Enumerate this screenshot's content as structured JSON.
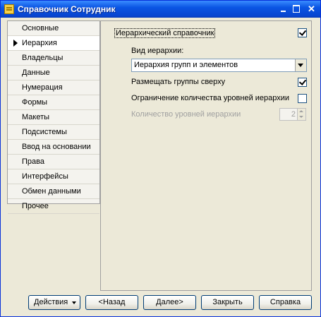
{
  "window": {
    "title": "Справочник Сотрудник"
  },
  "sidebar": {
    "items": [
      {
        "label": "Основные"
      },
      {
        "label": "Иерархия"
      },
      {
        "label": "Владельцы"
      },
      {
        "label": "Данные"
      },
      {
        "label": "Нумерация"
      },
      {
        "label": "Формы"
      },
      {
        "label": "Макеты"
      },
      {
        "label": "Подсистемы"
      },
      {
        "label": "Ввод на основании"
      },
      {
        "label": "Права"
      },
      {
        "label": "Интерфейсы"
      },
      {
        "label": "Обмен данными"
      },
      {
        "label": "Прочее"
      }
    ],
    "active_index": 1
  },
  "panel": {
    "hierarchical": {
      "label": "Иерархический справочник",
      "checked": true
    },
    "hierarchy_type": {
      "label": "Вид иерархии:",
      "value": "Иерархия групп и элементов"
    },
    "groups_on_top": {
      "label": "Размещать группы сверху",
      "checked": true
    },
    "limit_levels": {
      "label": "Ограничение количества уровней иерархии",
      "checked": false
    },
    "levels_count": {
      "label": "Количество уровней иерархии",
      "value": "2"
    }
  },
  "footer": {
    "actions_label": "Действия",
    "back_label": "<Назад",
    "next_label": "Далее>",
    "close_label": "Закрыть",
    "help_label": "Справка"
  }
}
